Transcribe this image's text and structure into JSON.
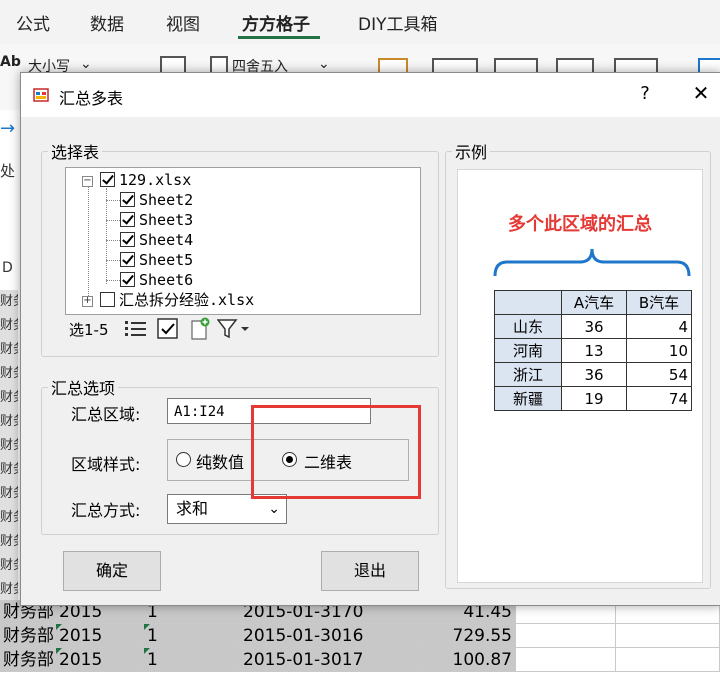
{
  "ribbon": {
    "tabs": [
      "公式",
      "数据",
      "视图",
      "方方格子",
      "DIY工具箱"
    ],
    "active_tab": "方方格子",
    "buttons": {
      "case": "大小写",
      "round": "四舍五入"
    },
    "fragments": {
      "ab": "Ab",
      "arrow": "→",
      "handle": "处",
      "col_d": "D"
    }
  },
  "sheet": {
    "left_column_text": "财务部",
    "rows": [
      {
        "dept": "财务部",
        "year": "2015",
        "num": "1",
        "date": "2015-01-3170",
        "amount": "41.45"
      },
      {
        "dept": "财务部",
        "year": "2015",
        "num": "1",
        "date": "2015-01-3016",
        "amount": "729.55"
      },
      {
        "dept": "财务部",
        "year": "2015",
        "num": "1",
        "date": "2015-01-3017",
        "amount": "100.87"
      }
    ]
  },
  "dialog": {
    "title": "汇总多表",
    "help": "?",
    "close": "✕",
    "select_group": "选择表",
    "tree": {
      "root_file": "129.xlsx",
      "sheets": [
        "Sheet2",
        "Sheet3",
        "Sheet4",
        "Sheet5",
        "Sheet6"
      ],
      "second_file": "汇总拆分经验.xlsx"
    },
    "toolbar": {
      "select_range": "选1-5"
    },
    "options_group": "汇总选项",
    "range_label": "汇总区域:",
    "range_value": "A1:I24",
    "style_label": "区域样式:",
    "style_options": [
      "纯数值",
      "二维表"
    ],
    "style_selected": "二维表",
    "method_label": "汇总方式:",
    "method_value": "求和",
    "ok_button": "确定",
    "exit_button": "退出",
    "example_group": "示例",
    "example": {
      "caption": "多个此区域的汇总",
      "headers": [
        "",
        "A汽车",
        "B汽车"
      ],
      "rows": [
        {
          "region": "山东",
          "a": "36",
          "b": "4"
        },
        {
          "region": "河南",
          "a": "13",
          "b": "10"
        },
        {
          "region": "浙江",
          "a": "36",
          "b": "54"
        },
        {
          "region": "新疆",
          "a": "19",
          "b": "74"
        }
      ]
    }
  },
  "colors": {
    "accent": "#217346",
    "highlight": "#e53935",
    "caption": "#e53935",
    "brace": "#1f77c9",
    "table_header": "#dbe5f1"
  }
}
